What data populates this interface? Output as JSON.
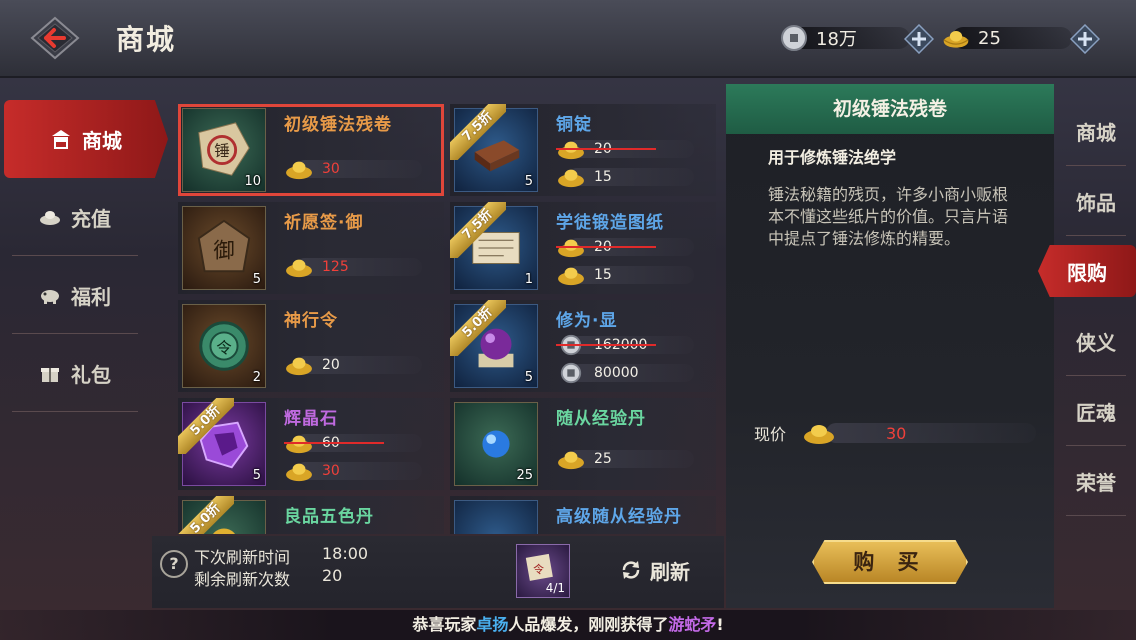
{
  "header": {
    "title": "商城",
    "silver": "18万",
    "gold": "25"
  },
  "left_nav": [
    {
      "label": "商城",
      "icon": "shop-icon",
      "active": true
    },
    {
      "label": "充值",
      "icon": "ingot-icon",
      "active": false
    },
    {
      "label": "福利",
      "icon": "piggy-icon",
      "active": false
    },
    {
      "label": "礼包",
      "icon": "gift-icon",
      "active": false
    }
  ],
  "items": [
    {
      "name": "初级锤法残卷",
      "qty": "10",
      "discount": "",
      "old_price": "",
      "price": "30",
      "price_red": true,
      "currency": "gold",
      "color": "orange",
      "thumb": "green",
      "selected": true
    },
    {
      "name": "铜锭",
      "qty": "5",
      "discount": "7.5折",
      "old_price": "20",
      "price": "15",
      "price_red": false,
      "currency": "gold",
      "color": "blue",
      "thumb": "blue"
    },
    {
      "name": "祈愿签·御",
      "qty": "5",
      "discount": "",
      "old_price": "",
      "price": "125",
      "price_red": true,
      "currency": "gold",
      "color": "orange",
      "thumb": "brown"
    },
    {
      "name": "学徒锻造图纸",
      "qty": "1",
      "discount": "7.5折",
      "old_price": "20",
      "price": "15",
      "price_red": false,
      "currency": "gold",
      "color": "blue",
      "thumb": "blue"
    },
    {
      "name": "神行令",
      "qty": "2",
      "discount": "",
      "old_price": "",
      "price": "20",
      "price_red": false,
      "currency": "gold",
      "color": "orange",
      "thumb": "brown"
    },
    {
      "name": "修为·显",
      "qty": "5",
      "discount": "5.0折",
      "old_price": "162000",
      "price": "80000",
      "price_red": false,
      "currency": "silver",
      "color": "blue",
      "thumb": "blue"
    },
    {
      "name": "辉晶石",
      "qty": "5",
      "discount": "5.0折",
      "old_price": "60",
      "price": "30",
      "price_red": true,
      "currency": "gold",
      "color": "purple",
      "thumb": "purple"
    },
    {
      "name": "随从经验丹",
      "qty": "25",
      "discount": "",
      "old_price": "",
      "price": "25",
      "price_red": false,
      "currency": "gold",
      "color": "green",
      "thumb": "green"
    },
    {
      "name": "良品五色丹",
      "qty": "",
      "discount": "5.0折",
      "old_price": "",
      "price": "",
      "price_red": false,
      "currency": "gold",
      "color": "green",
      "thumb": "green"
    },
    {
      "name": "高级随从经验丹",
      "qty": "",
      "discount": "",
      "old_price": "",
      "price": "",
      "price_red": false,
      "currency": "gold",
      "color": "blue",
      "thumb": "blue"
    }
  ],
  "refresh": {
    "next_label": "下次刷新时间",
    "next_value": "18:00",
    "remain_label": "剩余刷新次数",
    "remain_value": "20",
    "item_qty": "4/1",
    "button": "刷新"
  },
  "detail": {
    "title": "初级锤法残卷",
    "subtitle": "用于修炼锤法绝学",
    "description": "锤法秘籍的残页，许多小商小贩根本不懂这些纸片的价值。只言片语中提点了锤法修炼的精要。",
    "price_label": "现价",
    "price": "30",
    "buy": "购 买"
  },
  "right_tabs": [
    {
      "label": "商城",
      "active": false
    },
    {
      "label": "饰品",
      "active": false
    },
    {
      "label": "限购",
      "active": true
    },
    {
      "label": "侠义",
      "active": false
    },
    {
      "label": "匠魂",
      "active": false
    },
    {
      "label": "荣誉",
      "active": false
    }
  ],
  "marquee": {
    "prefix": "恭喜玩家",
    "player": "卓扬",
    "middle": "人品爆发，刚刚获得了",
    "item": "游蛇矛",
    "suffix": "!"
  },
  "colors": {
    "accent_red": "#c62c2a",
    "detail_header_green": "#2c7a5a",
    "buy_gold": "#e8be58",
    "price_red": "#f0403a"
  }
}
